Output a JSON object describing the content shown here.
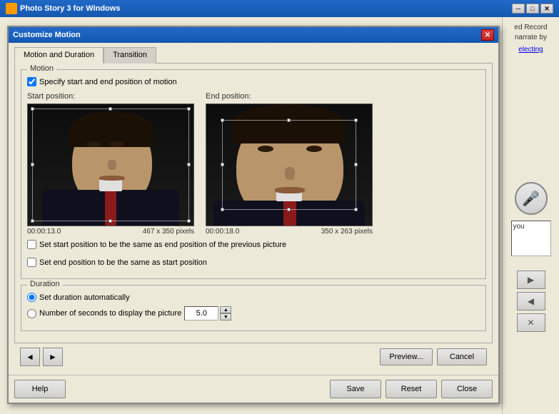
{
  "app": {
    "title": "Photo Story 3 for Windows",
    "icon": "📷"
  },
  "dialog": {
    "title": "Customize Motion",
    "tabs": [
      {
        "id": "motion",
        "label": "Motion and Duration",
        "active": true
      },
      {
        "id": "transition",
        "label": "Transition",
        "active": false
      }
    ],
    "motion_group": {
      "label": "Motion",
      "specify_checkbox": {
        "label": "Specify start and end position of motion",
        "checked": true
      },
      "start_position": {
        "label": "Start position:",
        "timestamp": "00:00:13.0",
        "dimensions": "467 x 350 pixels"
      },
      "end_position": {
        "label": "End position:",
        "timestamp": "00:00:18.0",
        "dimensions": "350 x 263 pixels"
      },
      "checkbox_same_as_prev": {
        "label": "Set start position to be the same as end position of the previous picture",
        "checked": false
      },
      "checkbox_same_as_start": {
        "label": "Set end position to be the same as start position",
        "checked": false
      }
    },
    "duration_group": {
      "label": "Duration",
      "auto_radio": {
        "label": "Set duration automatically",
        "checked": true
      },
      "seconds_radio": {
        "label": "Number of seconds to display the picture",
        "checked": false
      },
      "seconds_value": "5.0"
    },
    "footer": {
      "preview_btn": "Preview...",
      "cancel_btn": "Cancel"
    },
    "main_footer": {
      "help_btn": "Help",
      "save_btn": "Save",
      "reset_btn": "Reset",
      "close_btn": "Close"
    }
  },
  "background": {
    "text_lines": [
      "ed Record",
      "narrate by",
      "",
      "electing"
    ],
    "textbox_content": "you"
  },
  "icons": {
    "close": "✕",
    "minimize": "─",
    "maximize": "□",
    "prev_arrow": "◄",
    "next_arrow": "►",
    "mic": "🎤",
    "arrow_right": "▶",
    "arrow_left": "◀",
    "arrow_x": "✕",
    "spinner_up": "▲",
    "spinner_down": "▼"
  }
}
